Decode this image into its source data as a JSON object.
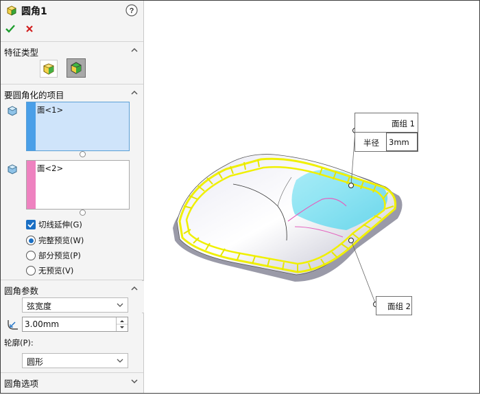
{
  "header": {
    "title": "圆角1",
    "help_icon": "question-circle-icon"
  },
  "actions": {
    "ok_icon": "check-icon",
    "cancel_icon": "close-icon",
    "ok_color": "#1e9e2e",
    "cancel_color": "#d11f1f"
  },
  "feature_type": {
    "title": "特征类型"
  },
  "items": {
    "title": "要圆角化的项目",
    "box1": {
      "text": "面<1>",
      "color": "#4a9fe8"
    },
    "box2": {
      "text": "面<2>",
      "color": "#ee82c0"
    },
    "tangent_propagation": {
      "label": "切线延伸(G)",
      "checked": true
    },
    "preview_options": [
      {
        "label": "完整预览(W)",
        "selected": true
      },
      {
        "label": "部分预览(P)",
        "selected": false
      },
      {
        "label": "无预览(V)",
        "selected": false
      }
    ]
  },
  "params": {
    "title": "圆角参数",
    "method": "弦宽度",
    "distance": "3.00mm",
    "profile_label": "轮廓(P):",
    "profile": "圆形"
  },
  "options": {
    "title": "圆角选项"
  },
  "callouts": {
    "face_set_1": "面组 1",
    "radius_label": "半径",
    "radius_value": "3mm",
    "face_set_2": "面组 2"
  }
}
